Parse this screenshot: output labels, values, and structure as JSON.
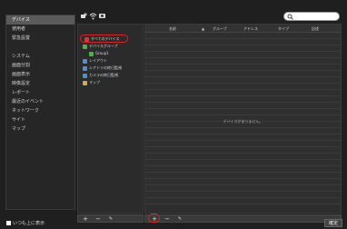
{
  "nav": {
    "items": [
      "デバイス",
      "使用者",
      "緊急設置"
    ],
    "items2": [
      "システム",
      "画面分割",
      "画面表示",
      "映像設定",
      "レポート",
      "最近のイベント",
      "ネットワーク",
      "サイト",
      "マップ"
    ],
    "active_index": 0
  },
  "toolbar": {
    "icons": [
      "add-device-icon",
      "wifi-icon",
      "camera-icon"
    ],
    "search_placeholder": ""
  },
  "tree": {
    "items": [
      {
        "label": "すべてのデバイス",
        "icon": "devices-icon",
        "color": "#d33"
      },
      {
        "label": "デバイスグループ",
        "icon": "group-icon",
        "color": "#4caf50"
      },
      {
        "label": "Group1",
        "icon": "group-icon",
        "color": "#4caf50"
      },
      {
        "label": "レイアウト",
        "icon": "layout-icon",
        "color": "#4a8fd8"
      },
      {
        "label": "シアトリの終日監視",
        "icon": "layout-icon",
        "color": "#4a8fd8"
      },
      {
        "label": "カメラの終日監視",
        "icon": "layout-icon",
        "color": "#4a8fd8"
      },
      {
        "label": "マップ",
        "icon": "map-icon",
        "color": "#d8a84a"
      }
    ]
  },
  "table": {
    "columns": [
      "名前",
      "グループ",
      "アドレス",
      "タイプ",
      "記述"
    ],
    "sort_marker": "▲",
    "empty_text": "デバイスがありません。"
  },
  "footer": {
    "checkbox_label": "いつも上に表示",
    "ok_label": "確定"
  },
  "bottom": {
    "add": "+",
    "remove": "−",
    "edit": "✎"
  }
}
